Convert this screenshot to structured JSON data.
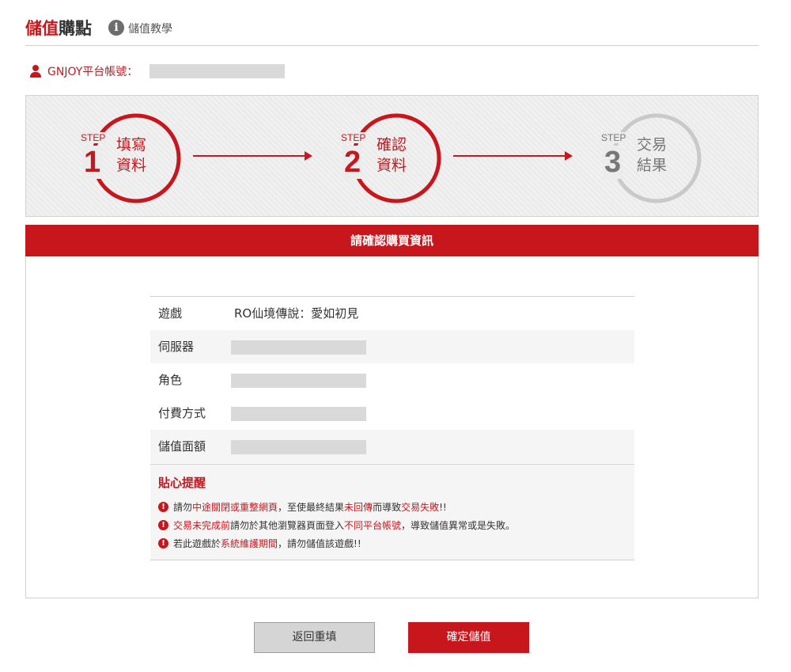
{
  "header": {
    "title_part1": "儲值",
    "title_part2": "購點",
    "info_icon": "i",
    "tutorial_link": "儲值教學"
  },
  "account": {
    "label": "GNJOY平台帳號："
  },
  "steps": [
    {
      "word": "STEP",
      "number": "1",
      "line1": "填寫",
      "line2": "資料",
      "state": "done"
    },
    {
      "word": "STEP",
      "number": "2",
      "line1": "確認",
      "line2": "資料",
      "state": "current"
    },
    {
      "word": "STEP",
      "number": "3",
      "line1": "交易",
      "line2": "結果",
      "state": "pending"
    }
  ],
  "panel": {
    "title": "請確認購買資訊",
    "rows": [
      {
        "label": "遊戲",
        "value": "RO仙境傳說：愛如初見"
      },
      {
        "label": "伺服器",
        "value": ""
      },
      {
        "label": "角色",
        "value": ""
      },
      {
        "label": "付費方式",
        "value": ""
      },
      {
        "label": "儲值面額",
        "value": ""
      }
    ]
  },
  "tips": {
    "title": "貼心提醒",
    "icon": "!",
    "items": [
      [
        {
          "t": "請勿",
          "h": false
        },
        {
          "t": "中途關閉或重整網頁",
          "h": true
        },
        {
          "t": "，至使最終結果",
          "h": false
        },
        {
          "t": "未回傳",
          "h": true
        },
        {
          "t": "而導致",
          "h": false
        },
        {
          "t": "交易失敗",
          "h": true
        },
        {
          "t": "!!",
          "h": false
        }
      ],
      [
        {
          "t": "交易未完成前",
          "h": true
        },
        {
          "t": "請勿於其他瀏覽器頁面登入",
          "h": false
        },
        {
          "t": "不同平台帳號",
          "h": true
        },
        {
          "t": "，導致儲值異常或是失敗。",
          "h": false
        }
      ],
      [
        {
          "t": "若此遊戲於",
          "h": false
        },
        {
          "t": "系統維護期間",
          "h": true
        },
        {
          "t": "，請勿儲值該遊戲!!",
          "h": false
        }
      ]
    ]
  },
  "buttons": {
    "back": "返回重填",
    "confirm": "確定儲值"
  },
  "colors": {
    "accent": "#c8161d",
    "inactive": "#777777",
    "mask": "#d9d9d9"
  }
}
